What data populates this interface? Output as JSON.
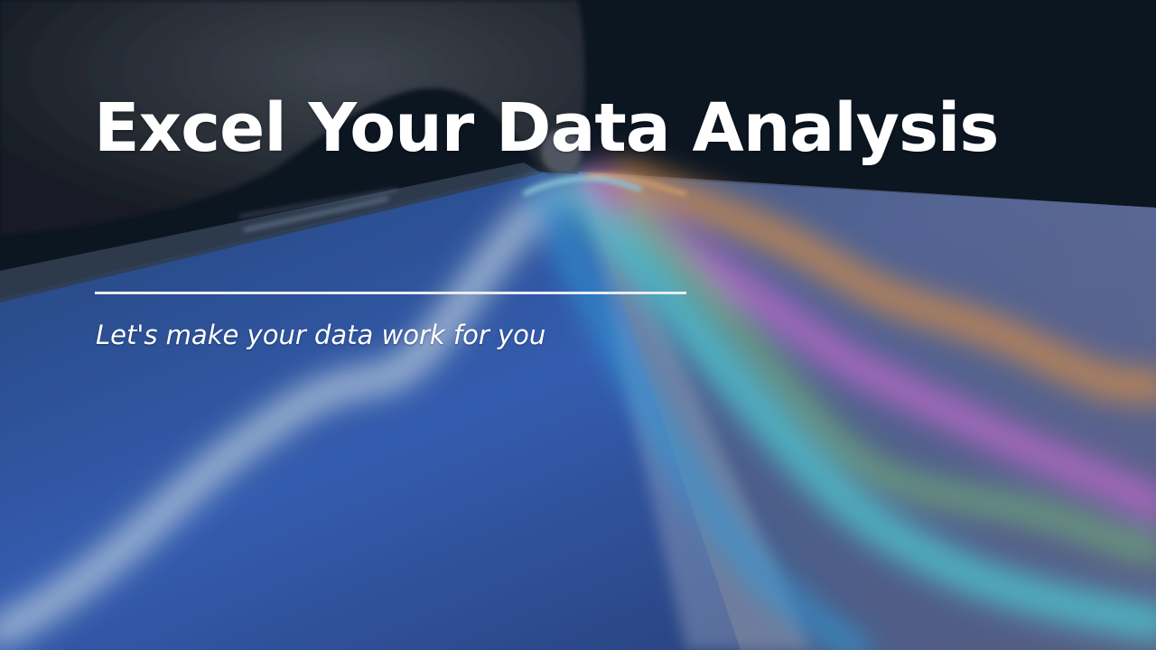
{
  "slide": {
    "title": "Excel Your Data Analysis",
    "subtitle": "Let's make your data work for you"
  },
  "background": {
    "description_icon": "tablet-chart-photo",
    "colors": {
      "dark": "#0b1420",
      "blue": "#3d6fd6",
      "cyan": "#5fe3f0",
      "orange": "#f2a35a",
      "magenta": "#d77be8",
      "green": "#8fe08a"
    }
  },
  "rule_color": "#e7ecf2"
}
